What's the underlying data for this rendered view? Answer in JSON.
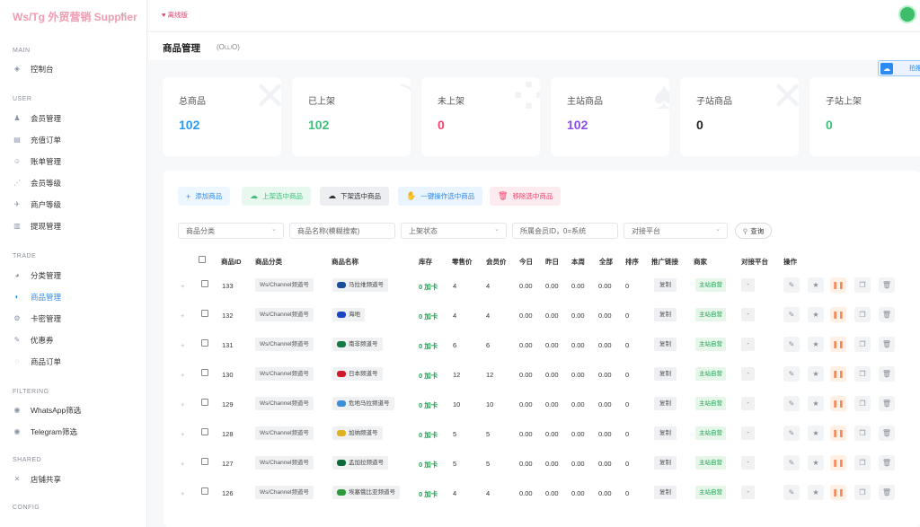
{
  "app": {
    "brand": "Ws/Tg 外贸营销 Supplier",
    "collapse_icon": "«",
    "version_badge": "♥ 离线版"
  },
  "sidebar": {
    "sections": [
      {
        "title": "MAIN",
        "items": [
          {
            "label": "控制台",
            "icon": "◈"
          }
        ]
      },
      {
        "title": "USER",
        "items": [
          {
            "label": "会员管理",
            "icon": "♟"
          },
          {
            "label": "充值订单",
            "icon": "▤"
          },
          {
            "label": "账单管理",
            "icon": "☺"
          },
          {
            "label": "会员等级",
            "icon": "⋰"
          },
          {
            "label": "商户等级",
            "icon": "✈"
          },
          {
            "label": "提现管理",
            "icon": "▥"
          }
        ]
      },
      {
        "title": "TRADE",
        "items": [
          {
            "label": "分类管理",
            "icon": "◕"
          },
          {
            "label": "商品管理",
            "icon": "◐"
          },
          {
            "label": "卡密管理",
            "icon": "⚙"
          },
          {
            "label": "优惠券",
            "icon": "✎"
          },
          {
            "label": "商品订单",
            "icon": "◌"
          }
        ]
      },
      {
        "title": "FILTERING",
        "items": [
          {
            "label": "WhatsApp筛选",
            "icon": "◉"
          },
          {
            "label": "Telegram筛选",
            "icon": "◉"
          }
        ]
      },
      {
        "title": "SHARED",
        "items": [
          {
            "label": "店铺共享",
            "icon": "✕"
          }
        ]
      },
      {
        "title": "CONFIG",
        "items": []
      }
    ],
    "active": "商品管理"
  },
  "page": {
    "title": "商品管理",
    "subtitle": "(O⩊O)"
  },
  "float_button": {
    "label": "拍推"
  },
  "stats": [
    {
      "label": "总商品",
      "value": "102",
      "color": "#2b9bf2"
    },
    {
      "label": "已上架",
      "value": "102",
      "color": "#3ec07c"
    },
    {
      "label": "未上架",
      "value": "0",
      "color": "#f0466f"
    },
    {
      "label": "主站商品",
      "value": "102",
      "color": "#8a4ee6"
    },
    {
      "label": "子站商品",
      "value": "0",
      "color": "#222222"
    },
    {
      "label": "子站上架",
      "value": "0",
      "color": "#3ec07c"
    }
  ],
  "actions": [
    {
      "label": "添加商品",
      "icon": "+",
      "bg": "#eef6ff",
      "color": "#2b8bf2"
    },
    {
      "label": "上架选中商品",
      "icon": "☁",
      "bg": "#e9f8ee",
      "color": "#3ec07c"
    },
    {
      "label": "下架选中商品",
      "icon": "☁",
      "bg": "#eceef2",
      "color": "#333333"
    },
    {
      "label": "一键操作选中商品",
      "icon": "✋",
      "bg": "#eaf4ff",
      "color": "#2b8bf2"
    },
    {
      "label": "移除选中商品",
      "icon": "🗑",
      "bg": "#fdecef",
      "color": "#f0466f"
    }
  ],
  "filters": {
    "category": "商品分类",
    "name_placeholder": "商品名称(模糊搜索)",
    "status": "上架状态",
    "member_placeholder": "所属会员ID，0=系统",
    "platform": "对接平台",
    "query": "查询"
  },
  "table": {
    "headers": [
      "商品ID",
      "商品分类",
      "商品名称",
      "库存",
      "零售价",
      "会员价",
      "今日",
      "昨日",
      "本周",
      "全部",
      "排序",
      "推广链接",
      "商家",
      "对接平台",
      "操作"
    ],
    "rows": [
      {
        "id": "133",
        "category": "Ws/Channel频道号",
        "name": "马拉维频道号",
        "flag": "#1a4fa0",
        "stock_num": "0",
        "stock_add": "加卡",
        "retail": "4",
        "member": "4",
        "today": "0.00",
        "yesterday": "0.00",
        "week": "0.00",
        "all": "0.00",
        "sort": "0",
        "link": "复制",
        "merchant": "主站自营",
        "platform": "-"
      },
      {
        "id": "132",
        "category": "Ws/Channel频道号",
        "name": "海地",
        "flag": "#1b46c4",
        "stock_num": "0",
        "stock_add": "加卡",
        "retail": "4",
        "member": "4",
        "today": "0.00",
        "yesterday": "0.00",
        "week": "0.00",
        "all": "0.00",
        "sort": "0",
        "link": "复制",
        "merchant": "主站自营",
        "platform": "-"
      },
      {
        "id": "131",
        "category": "Ws/Channel频道号",
        "name": "南非频道号",
        "flag": "#167a45",
        "stock_num": "0",
        "stock_add": "加卡",
        "retail": "6",
        "member": "6",
        "today": "0.00",
        "yesterday": "0.00",
        "week": "0.00",
        "all": "0.00",
        "sort": "0",
        "link": "复制",
        "merchant": "主站自营",
        "platform": "-"
      },
      {
        "id": "130",
        "category": "Ws/Channel频道号",
        "name": "日本频道号",
        "flag": "#d11a2a",
        "stock_num": "0",
        "stock_add": "加卡",
        "retail": "12",
        "member": "12",
        "today": "0.00",
        "yesterday": "0.00",
        "week": "0.00",
        "all": "0.00",
        "sort": "0",
        "link": "复制",
        "merchant": "主站自营",
        "platform": "-"
      },
      {
        "id": "129",
        "category": "Ws/Channel频道号",
        "name": "危地马拉频道号",
        "flag": "#3b8ed8",
        "stock_num": "0",
        "stock_add": "加卡",
        "retail": "10",
        "member": "10",
        "today": "0.00",
        "yesterday": "0.00",
        "week": "0.00",
        "all": "0.00",
        "sort": "0",
        "link": "复制",
        "merchant": "主站自营",
        "platform": "-"
      },
      {
        "id": "128",
        "category": "Ws/Channel频道号",
        "name": "加纳频道号",
        "flag": "#e0b020",
        "stock_num": "0",
        "stock_add": "加卡",
        "retail": "5",
        "member": "5",
        "today": "0.00",
        "yesterday": "0.00",
        "week": "0.00",
        "all": "0.00",
        "sort": "0",
        "link": "复制",
        "merchant": "主站自营",
        "platform": "-"
      },
      {
        "id": "127",
        "category": "Ws/Channel频道号",
        "name": "孟加拉频道号",
        "flag": "#0a6a3a",
        "stock_num": "0",
        "stock_add": "加卡",
        "retail": "5",
        "member": "5",
        "today": "0.00",
        "yesterday": "0.00",
        "week": "0.00",
        "all": "0.00",
        "sort": "0",
        "link": "复制",
        "merchant": "主站自营",
        "platform": "-"
      },
      {
        "id": "126",
        "category": "Ws/Channel频道号",
        "name": "埃塞俄比亚频道号",
        "flag": "#2a9a3a",
        "stock_num": "0",
        "stock_add": "加卡",
        "retail": "4",
        "member": "4",
        "today": "0.00",
        "yesterday": "0.00",
        "week": "0.00",
        "all": "0.00",
        "sort": "0",
        "link": "复制",
        "merchant": "主站自营",
        "platform": "-"
      }
    ],
    "row_ops": [
      {
        "name": "edit-icon",
        "glyph": "✎"
      },
      {
        "name": "star-icon",
        "glyph": "★"
      },
      {
        "name": "pause-icon",
        "glyph": "❚❚"
      },
      {
        "name": "copy-icon",
        "glyph": "❐"
      },
      {
        "name": "trash-icon",
        "glyph": "🗑"
      }
    ]
  }
}
